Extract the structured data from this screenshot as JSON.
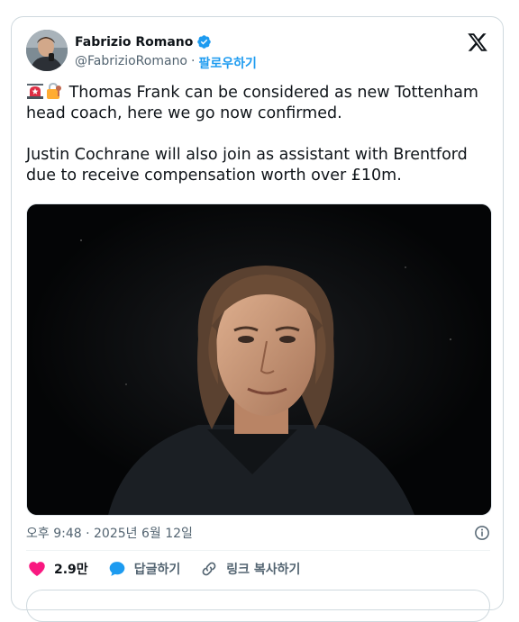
{
  "author": {
    "name": "Fabrizio Romano",
    "handle": "@FabrizioRomano",
    "separator": "·",
    "follow_label": "팔로우하기"
  },
  "tweet": {
    "paragraph1": "Thomas Frank can be considered as new Tottenham head coach, here we go now confirmed.",
    "paragraph2": "Justin Cochrane will also join as assistant with Brentford due to receive compensation worth over £10m."
  },
  "meta": {
    "timestamp": "오후 9:48 · 2025년 6월 12일"
  },
  "actions": {
    "likes_count": "2.9만",
    "reply_label": "답글하기",
    "copy_link_label": "링크 복사하기"
  },
  "icons": [
    "verified-badge-icon",
    "x-logo-icon",
    "siren-emoji-icon",
    "lock-emoji-icon",
    "info-icon",
    "heart-icon",
    "reply-bubble-icon",
    "link-icon"
  ],
  "colors": {
    "accent": "#1d9bf0",
    "like": "#f91880",
    "text": "#0f1419",
    "muted": "#536471"
  }
}
